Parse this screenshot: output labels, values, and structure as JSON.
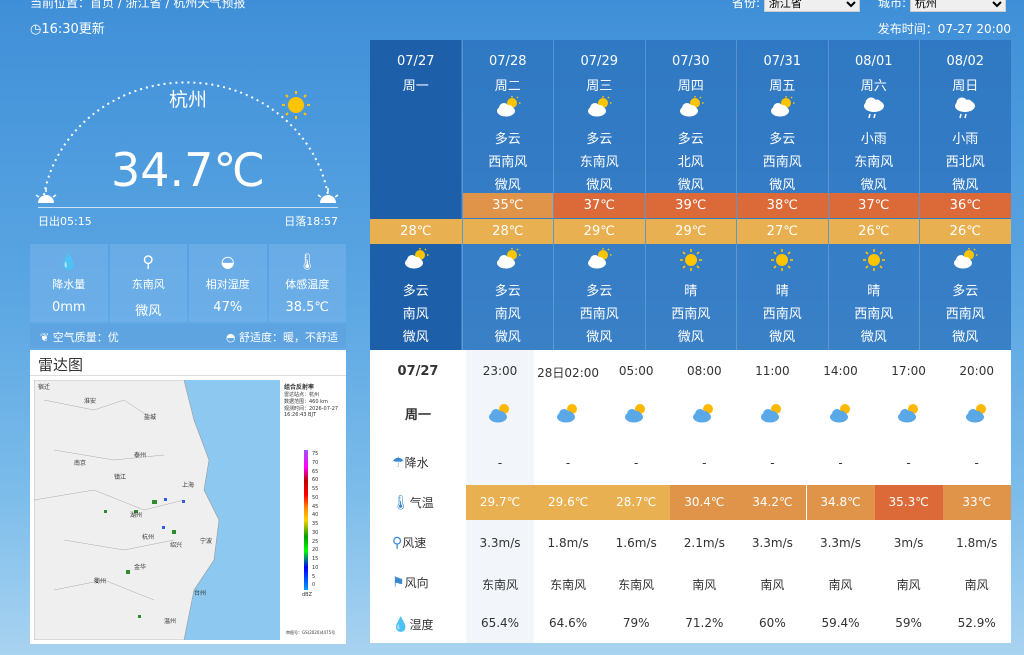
{
  "top": {
    "location": "当前位置：首页 / 浙江省 / 杭州天气预报",
    "province_label": "省份:",
    "province": "浙江省",
    "city_label": "城市:",
    "city": "杭州",
    "update": "16:30更新",
    "publish": "发布时间：07-27 20:00"
  },
  "current": {
    "city": "杭州",
    "temp": "34.7℃",
    "sunrise": "日出05:15",
    "sunset": "日落18:57"
  },
  "stats": [
    {
      "label": "降水量",
      "value": "0mm",
      "icon": "rain-drops-icon"
    },
    {
      "label": "东南风",
      "value": "微风",
      "icon": "wind-turbine-icon"
    },
    {
      "label": "相对湿度",
      "value": "47%",
      "icon": "humidity-drop-icon"
    },
    {
      "label": "体感温度",
      "value": "38.5℃",
      "icon": "thermometer-icon"
    }
  ],
  "air": {
    "quality": "空气质量：优",
    "comfort": "舒适度：暖，不舒适"
  },
  "radar": {
    "title": "雷达图",
    "legend_title": "组合反射率",
    "legend_lines": [
      "雷达站点：杭州",
      "数据范围：460 km",
      "观测时间：2026-07-27",
      "16:26:43 BJT"
    ],
    "scale": [
      "75",
      "70",
      "65",
      "60",
      "55",
      "50",
      "45",
      "40",
      "35",
      "30",
      "25",
      "20",
      "15",
      "10",
      "5",
      "0"
    ],
    "unit": "dBZ",
    "footer": "审图号：GS(2020)4475号",
    "places": [
      "宿迁",
      "淮安",
      "盐城",
      "泰州",
      "南京",
      "镇江",
      "上海",
      "湖州",
      "杭州",
      "绍兴",
      "宁波",
      "金华",
      "衢州",
      "温州",
      "台州"
    ]
  },
  "forecast": [
    {
      "date": "07/27",
      "week": "周一",
      "day": null,
      "hi": null,
      "lo": "28℃",
      "night": {
        "weather": "多云",
        "dir": "南风",
        "speed": "微风"
      }
    },
    {
      "date": "07/28",
      "week": "周二",
      "day": {
        "weather": "多云",
        "dir": "西南风",
        "speed": "微风"
      },
      "hi": "35℃",
      "lo": "28℃",
      "night": {
        "weather": "多云",
        "dir": "南风",
        "speed": "微风"
      }
    },
    {
      "date": "07/29",
      "week": "周三",
      "day": {
        "weather": "多云",
        "dir": "东南风",
        "speed": "微风"
      },
      "hi": "37℃",
      "lo": "29℃",
      "night": {
        "weather": "多云",
        "dir": "西南风",
        "speed": "微风"
      }
    },
    {
      "date": "07/30",
      "week": "周四",
      "day": {
        "weather": "多云",
        "dir": "北风",
        "speed": "微风"
      },
      "hi": "39℃",
      "lo": "29℃",
      "night": {
        "weather": "晴",
        "dir": "西南风",
        "speed": "微风"
      }
    },
    {
      "date": "07/31",
      "week": "周五",
      "day": {
        "weather": "多云",
        "dir": "西南风",
        "speed": "微风"
      },
      "hi": "38℃",
      "lo": "27℃",
      "night": {
        "weather": "晴",
        "dir": "西南风",
        "speed": "微风"
      }
    },
    {
      "date": "08/01",
      "week": "周六",
      "day": {
        "weather": "小雨",
        "dir": "东南风",
        "speed": "微风"
      },
      "hi": "37℃",
      "lo": "26℃",
      "night": {
        "weather": "晴",
        "dir": "西南风",
        "speed": "微风"
      }
    },
    {
      "date": "08/02",
      "week": "周日",
      "day": {
        "weather": "小雨",
        "dir": "西北风",
        "speed": "微风"
      },
      "hi": "36℃",
      "lo": "26℃",
      "night": {
        "weather": "多云",
        "dir": "西南风",
        "speed": "微风"
      }
    }
  ],
  "hourly": {
    "date": "07/27",
    "week": "周一",
    "labels": {
      "rain": "降水",
      "temp": "气温",
      "wspd": "风速",
      "wdir": "风向",
      "hum": "湿度"
    },
    "items": [
      {
        "time": "23:00",
        "rain": "-",
        "temp": "29.7℃",
        "wspd": "3.3m/s",
        "wdir": "东南风",
        "hum": "65.4%",
        "tcolor": "#e8b050"
      },
      {
        "time": "28日02:00",
        "rain": "-",
        "temp": "29.6℃",
        "wspd": "1.8m/s",
        "wdir": "东南风",
        "hum": "64.6%",
        "tcolor": "#e8b050"
      },
      {
        "time": "05:00",
        "rain": "-",
        "temp": "28.7℃",
        "wspd": "1.6m/s",
        "wdir": "东南风",
        "hum": "79%",
        "tcolor": "#e8b050"
      },
      {
        "time": "08:00",
        "rain": "-",
        "temp": "30.4℃",
        "wspd": "2.1m/s",
        "wdir": "南风",
        "hum": "71.2%",
        "tcolor": "#e0944a"
      },
      {
        "time": "11:00",
        "rain": "-",
        "temp": "34.2℃",
        "wspd": "3.3m/s",
        "wdir": "南风",
        "hum": "60%",
        "tcolor": "#e0944a"
      },
      {
        "time": "14:00",
        "rain": "-",
        "temp": "34.8℃",
        "wspd": "3.3m/s",
        "wdir": "南风",
        "hum": "59.4%",
        "tcolor": "#e0944a"
      },
      {
        "time": "17:00",
        "rain": "-",
        "temp": "35.3℃",
        "wspd": "3m/s",
        "wdir": "南风",
        "hum": "59%",
        "tcolor": "#dc6a38"
      },
      {
        "time": "20:00",
        "rain": "-",
        "temp": "33℃",
        "wspd": "1.8m/s",
        "wdir": "南风",
        "hum": "52.9%",
        "tcolor": "#e0944a"
      }
    ]
  },
  "colors": {
    "hi_orange": "#e0944a",
    "hi_hot": "#dc6a38",
    "lo_yellow": "#e8b050",
    "today": "#1d5fa8"
  }
}
